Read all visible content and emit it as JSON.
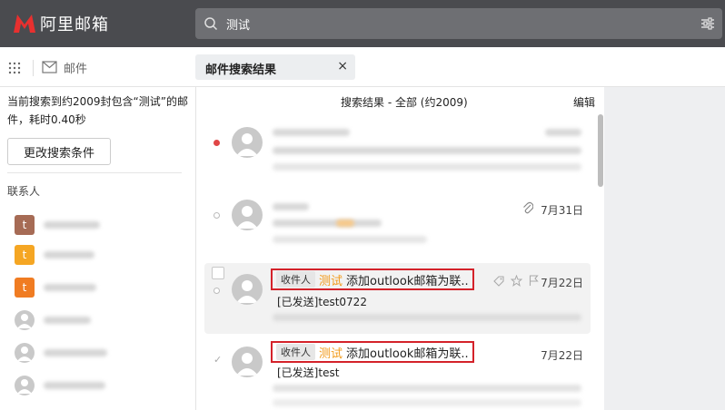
{
  "app": {
    "name": "阿里邮箱",
    "brand_color": "#e8302f"
  },
  "search": {
    "query": "测试",
    "icon": "search-icon",
    "filter_icon": "filter-icon"
  },
  "nav": {
    "mail_label": "邮件"
  },
  "tab": {
    "label": "邮件搜索结果",
    "close": "×"
  },
  "left": {
    "summary": "当前搜索到约2009封包含“测试”的邮件，耗时0.40秒",
    "modify_button": "更改搜索条件",
    "contacts_title": "联系人",
    "contacts": [
      {
        "initial": "t",
        "color": "#a66b55"
      },
      {
        "initial": "t",
        "color": "#f5a623"
      },
      {
        "initial": "t",
        "color": "#f07c22"
      },
      {
        "initial": "",
        "color": "#c9c9c9"
      },
      {
        "initial": "",
        "color": "#c9c9c9"
      },
      {
        "initial": "",
        "color": "#c9c9c9"
      }
    ]
  },
  "results": {
    "title": "搜索结果 - 全部 (约2009)",
    "edit": "编辑",
    "mails": [
      {
        "date": "",
        "status": "unread"
      },
      {
        "date": "7月31日",
        "status": "read"
      },
      {
        "tag": "收件人",
        "highlight": "测试",
        "subject": "添加outlook邮箱为联..",
        "sender": "[已发送]test0722",
        "date": "7月22日",
        "status": "read"
      },
      {
        "tag": "收件人",
        "highlight": "测试",
        "subject": "添加outlook邮箱为联..",
        "sender": "[已发送]test",
        "date": "7月22日",
        "status": "sent"
      }
    ]
  }
}
